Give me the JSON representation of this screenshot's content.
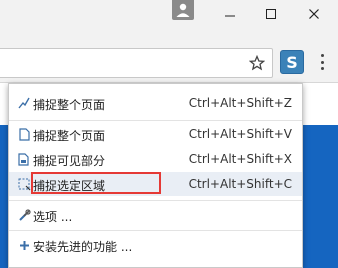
{
  "window": {
    "profile_icon": "person-icon",
    "minimize_icon": "minimize-icon",
    "maximize_icon": "maximize-icon",
    "close_icon": "close-icon"
  },
  "toolbar": {
    "star_icon": "star-icon",
    "extension_label": "S",
    "menu_icon": "more-vertical-icon"
  },
  "menu": {
    "items": [
      {
        "icon": "brush-icon",
        "label": "捕捉整个页面",
        "shortcut": "Ctrl+Alt+Shift+Z"
      },
      {
        "icon": "page-icon",
        "label": "捕捉整个页面",
        "shortcut": "Ctrl+Alt+Shift+V"
      },
      {
        "icon": "visible-area-icon",
        "label": "捕捉可见部分",
        "shortcut": "Ctrl+Alt+Shift+X"
      },
      {
        "icon": "selection-icon",
        "label": "捕捉选定区域",
        "shortcut": "Ctrl+Alt+Shift+C"
      },
      {
        "icon": "tools-icon",
        "label": "选项 ..."
      },
      {
        "icon": "plus-icon",
        "label": "安装先进的功能 ..."
      }
    ]
  },
  "colors": {
    "accent": "#3b82b8",
    "highlight_border": "#e53935",
    "page_blue": "#1565c0"
  }
}
